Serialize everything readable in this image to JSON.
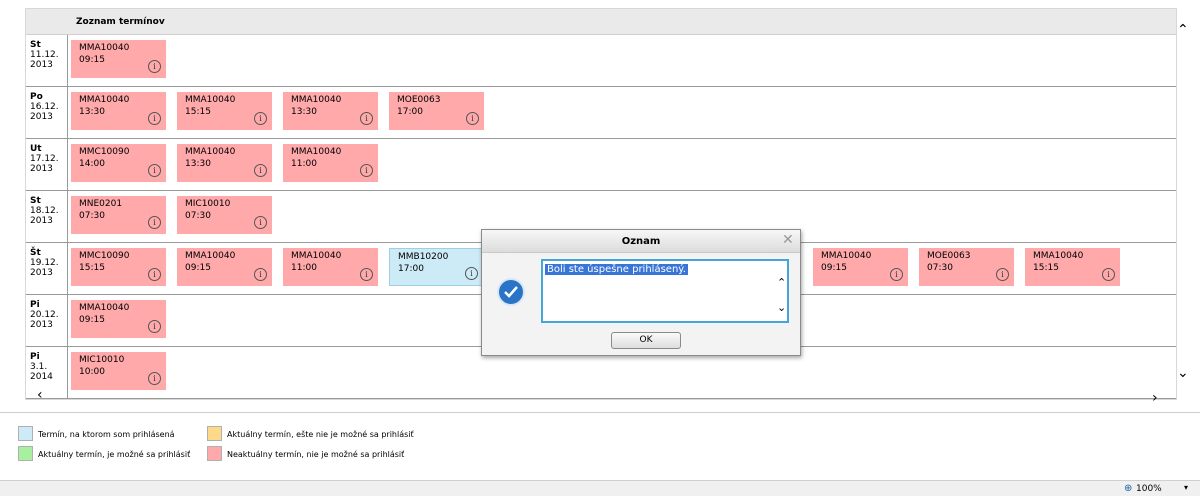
{
  "panel": {
    "title": "Zoznam termínov"
  },
  "rows": [
    {
      "day": "St",
      "date": "11.12.",
      "year": "2013",
      "terms": [
        {
          "code": "MMA10040",
          "time": "09:15",
          "status": "red"
        }
      ]
    },
    {
      "day": "Po",
      "date": "16.12.",
      "year": "2013",
      "terms": [
        {
          "code": "MMA10040",
          "time": "13:30",
          "status": "red"
        },
        {
          "code": "MMA10040",
          "time": "15:15",
          "status": "red"
        },
        {
          "code": "MMA10040",
          "time": "13:30",
          "status": "red"
        },
        {
          "code": "MOE0063",
          "time": "17:00",
          "status": "red"
        }
      ]
    },
    {
      "day": "Ut",
      "date": "17.12.",
      "year": "2013",
      "terms": [
        {
          "code": "MMC10090",
          "time": "14:00",
          "status": "red"
        },
        {
          "code": "MMA10040",
          "time": "13:30",
          "status": "red"
        },
        {
          "code": "MMA10040",
          "time": "11:00",
          "status": "red"
        }
      ]
    },
    {
      "day": "St",
      "date": "18.12.",
      "year": "2013",
      "terms": [
        {
          "code": "MNE0201",
          "time": "07:30",
          "status": "red"
        },
        {
          "code": "MIC10010",
          "time": "07:30",
          "status": "red"
        }
      ]
    },
    {
      "day": "Št",
      "date": "19.12.",
      "year": "2013",
      "terms": [
        {
          "code": "MMC10090",
          "time": "15:15",
          "status": "red"
        },
        {
          "code": "MMA10040",
          "time": "09:15",
          "status": "red"
        },
        {
          "code": "MMA10040",
          "time": "11:00",
          "status": "red"
        },
        {
          "code": "MMB10200",
          "time": "17:00",
          "status": "blue"
        },
        {
          "code": "",
          "time": "",
          "status": "hidden"
        },
        {
          "code": "",
          "time": "",
          "status": "hidden"
        },
        {
          "code": "",
          "time": "",
          "status": "hidden"
        },
        {
          "code": "MMA10040",
          "time": "09:15",
          "status": "red"
        },
        {
          "code": "MOE0063",
          "time": "07:30",
          "status": "red"
        },
        {
          "code": "MMA10040",
          "time": "15:15",
          "status": "red"
        }
      ]
    },
    {
      "day": "Pi",
      "date": "20.12.",
      "year": "2013",
      "terms": [
        {
          "code": "MMA10040",
          "time": "09:15",
          "status": "red"
        }
      ]
    },
    {
      "day": "Pi",
      "date": "3.1.",
      "year": "2014",
      "terms": [
        {
          "code": "MIC10010",
          "time": "10:00",
          "status": "red"
        }
      ]
    }
  ],
  "legend": [
    {
      "label": "Termín, na ktorom som prihlásená",
      "color": "#cdeaf7"
    },
    {
      "label": "Aktuálny termín, ešte nie je možné sa prihlásiť",
      "color": "#ffd98a"
    },
    {
      "label": "Aktuálny termín, je možné sa prihlásiť",
      "color": "#a8f0a0"
    },
    {
      "label": "Neaktuálny termín, nie je možné sa prihlásiť",
      "color": "#ffa9ab"
    }
  ],
  "dialog": {
    "title": "Oznam",
    "message": "Boli ste úspešne prihlásený.",
    "ok_label": "OK"
  },
  "status": {
    "zoom": "100%"
  },
  "colors": {
    "term_red": "#ffa9ab",
    "term_blue": "#cdeaf7",
    "dialog_border": "#43a6d6"
  },
  "icons": {
    "info": "info-icon",
    "check": "check-icon",
    "close": "close-icon",
    "zoom": "zoom-icon"
  }
}
